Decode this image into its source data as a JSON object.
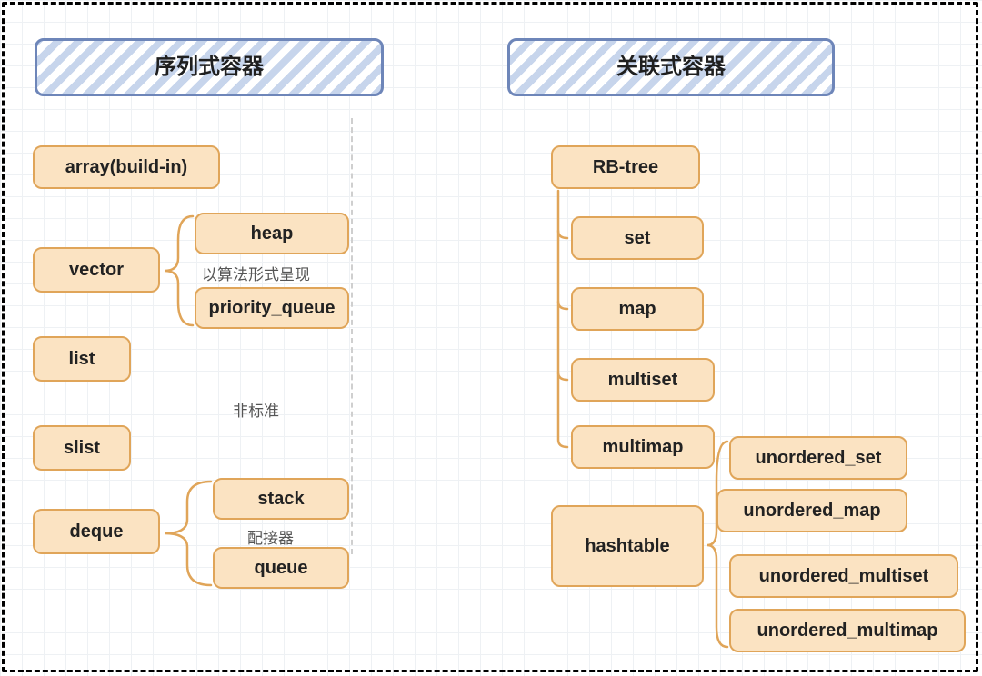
{
  "headers": {
    "sequential": "序列式容器",
    "associative": "关联式容器"
  },
  "sequential": {
    "array": "array(build-in)",
    "vector": "vector",
    "list": "list",
    "slist": "slist",
    "deque": "deque",
    "heap": "heap",
    "priority_queue": "priority_queue",
    "stack": "stack",
    "queue": "queue"
  },
  "associative": {
    "rbtree": "RB-tree",
    "set": "set",
    "map": "map",
    "multiset": "multiset",
    "multimap": "multimap",
    "hashtable": "hashtable",
    "unordered_set": "unordered_set",
    "unordered_map": "unordered_map",
    "unordered_multiset": "unordered_multiset",
    "unordered_multimap": "unordered_multimap"
  },
  "annotations": {
    "algorithm_form": "以算法形式呈现",
    "nonstandard": "非标准",
    "adapter": "配接器"
  }
}
